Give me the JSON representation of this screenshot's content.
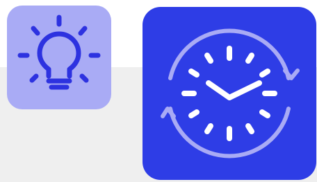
{
  "colors": {
    "page_background": "#ffffff",
    "band_background": "#efefef",
    "bulb_tile": "#a9abf5",
    "bulb_icon": "#2d32e0",
    "bulb_rays": "#2d32e0",
    "clock_tile": "#2e3de6",
    "clock_face": "#ffffff",
    "clock_arrows": "#a9abf5"
  },
  "icons": {
    "bulb": "lightbulb-icon",
    "clock": "clock-refresh-icon"
  }
}
